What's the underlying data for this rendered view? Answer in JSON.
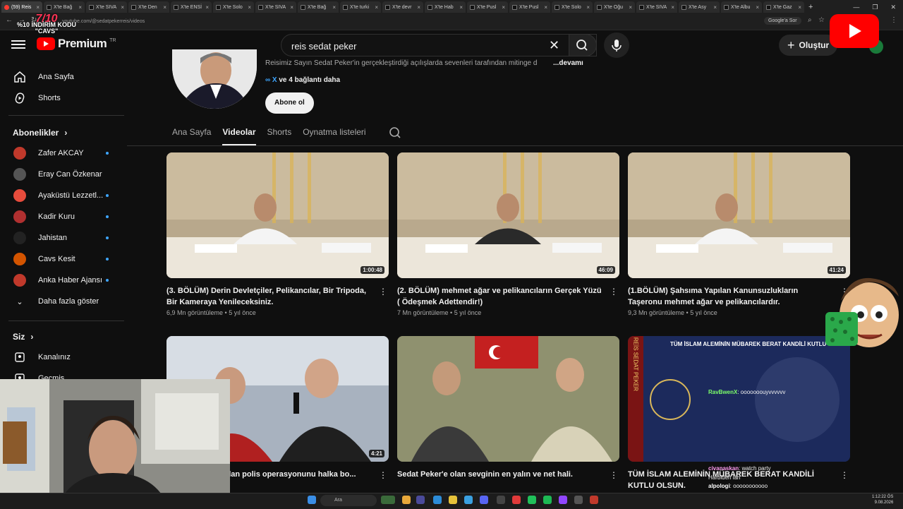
{
  "browser": {
    "tabs": [
      {
        "label": "(59) Reis",
        "active": true
      },
      {
        "label": "X'te Bağ"
      },
      {
        "label": "X'te SIVA"
      },
      {
        "label": "X'te Den"
      },
      {
        "label": "X'te ENSİ"
      },
      {
        "label": "X'te Solo"
      },
      {
        "label": "X'te SIVA"
      },
      {
        "label": "X'te Bağ"
      },
      {
        "label": "X'te turki"
      },
      {
        "label": "X'te devr"
      },
      {
        "label": "X'te Hab"
      },
      {
        "label": "X'te Pusl"
      },
      {
        "label": "X'te Pusl"
      },
      {
        "label": "X'te Solo"
      },
      {
        "label": "X'te Oğu"
      },
      {
        "label": "X'te SIVA"
      },
      {
        "label": "X'te Asy"
      },
      {
        "label": "X'te Albu"
      },
      {
        "label": "X'te Gaz"
      }
    ],
    "url": "youtube.com/@sedatpekerreis/videos",
    "google_lens": "Google'a Sor"
  },
  "promo": {
    "line1": "%10 İNDİRİM KODU",
    "line2": "\"CAVS\""
  },
  "header": {
    "logo_text": "Premium",
    "logo_region": "TR",
    "search_value": "reis sedat peker",
    "create_label": "Oluştur"
  },
  "sidebar": {
    "main": [
      {
        "label": "Ana Sayfa",
        "icon": "home-icon"
      },
      {
        "label": "Shorts",
        "icon": "shorts-icon"
      }
    ],
    "subs_title": "Abonelikler",
    "subs": [
      {
        "label": "Zafer AKCAY",
        "color": "#c0392b",
        "dot": true
      },
      {
        "label": "Eray Can Özkenar",
        "color": "#555555",
        "dot": false
      },
      {
        "label": "Ayaküstü Lezzetl...",
        "color": "#e74c3c",
        "dot": true
      },
      {
        "label": "Kadir Kuru",
        "color": "#b03030",
        "dot": true
      },
      {
        "label": "Jahistan",
        "color": "#222222",
        "dot": true
      },
      {
        "label": "Cavs Kesit",
        "color": "#d35400",
        "dot": true
      },
      {
        "label": "Anka Haber Ajansı",
        "color": "#c0392b",
        "dot": true
      }
    ],
    "more_label": "Daha fazla göster",
    "you_title": "Siz",
    "you_items": [
      {
        "label": "Kanalınız"
      },
      {
        "label": "Geçmiş"
      }
    ]
  },
  "channel": {
    "description": "Reisimiz Sayın Sedat Peker'in gerçekleştirdiği açılışlarda sevenleri tarafından mitinge d",
    "more": "...devamı",
    "links_prefix": "X",
    "links_suffix": "ve 4 bağlantı daha",
    "subscribe_label": "Abone ol",
    "tabs": [
      {
        "label": "Ana Sayfa",
        "active": false
      },
      {
        "label": "Videolar",
        "active": true
      },
      {
        "label": "Shorts",
        "active": false
      },
      {
        "label": "Oynatma listeleri",
        "active": false
      }
    ]
  },
  "videos": [
    {
      "title": "(3. BÖLÜM) Derin Devletçiler, Pelikancılar, Bir Tripoda, Bir Kameraya Yenilecek­siniz.",
      "meta": "6,9 Mn görüntüleme • 5 yıl önce",
      "duration": "1:00:48",
      "thumb": "#b8a88c"
    },
    {
      "title": "(2. BÖLÜM) mehmet ağar ve pelikancıların Gerçek Yüzü ( Ödeşmek Adettendir!)",
      "meta": "7 Mn görüntüleme • 5 yıl önce",
      "duration": "46:09",
      "thumb": "#b9a98d"
    },
    {
      "title": "(1.BÖLÜM) Şahsıma Yapılan Kanunsuzlukların Taşeronu mehmet ağar ve pelikancılardır.",
      "meta": "9,3 Mn görüntüleme • 5 yıl önce",
      "duration": "41:24",
      "thumb": "#b5a588"
    },
    {
      "title": "Dün Ailem'e Yapılan polis operasyonunu halka bo...",
      "meta": "",
      "duration": "4:21",
      "thumb": "#8a8f9a"
    },
    {
      "title": "Sedat Peker'e olan sevginin en yalın ve net hali.",
      "meta": "",
      "duration": "",
      "thumb": "#8a8a6e"
    },
    {
      "title": "TÜM İSLAM ALEMİNİN MÜBAREK BERAT KANDİLİ KUTLU OLSUN.",
      "meta": "",
      "duration": "",
      "thumb": "#1c2a5c"
    }
  ],
  "thumb_text": {
    "poster_side": "REİS SEDAT PEKER",
    "poster_head": "TÜM İSLAM ALEMİNİN MÜBAREK BERAT KANDİLİ KUTLU OLSUN"
  },
  "chat": [
    {
      "user": "RavBwenX",
      "msg": ": ooooooouyvvvvvv",
      "ucolor": "#7dff6a"
    },
    {
      "user": "civanaskan",
      "msg": ": watch party",
      "ucolor": "#ff9cf2"
    },
    {
      "user": "",
      "msg": "Harbiden lan",
      "ucolor": "#ffffff"
    },
    {
      "user": "alpologi",
      "msg": ": ooooooooooo",
      "ucolor": "#ffffff"
    }
  ],
  "taskbar": {
    "search": "Ara",
    "time": "1:12:22 ÖS",
    "date": "9.08.2026"
  }
}
